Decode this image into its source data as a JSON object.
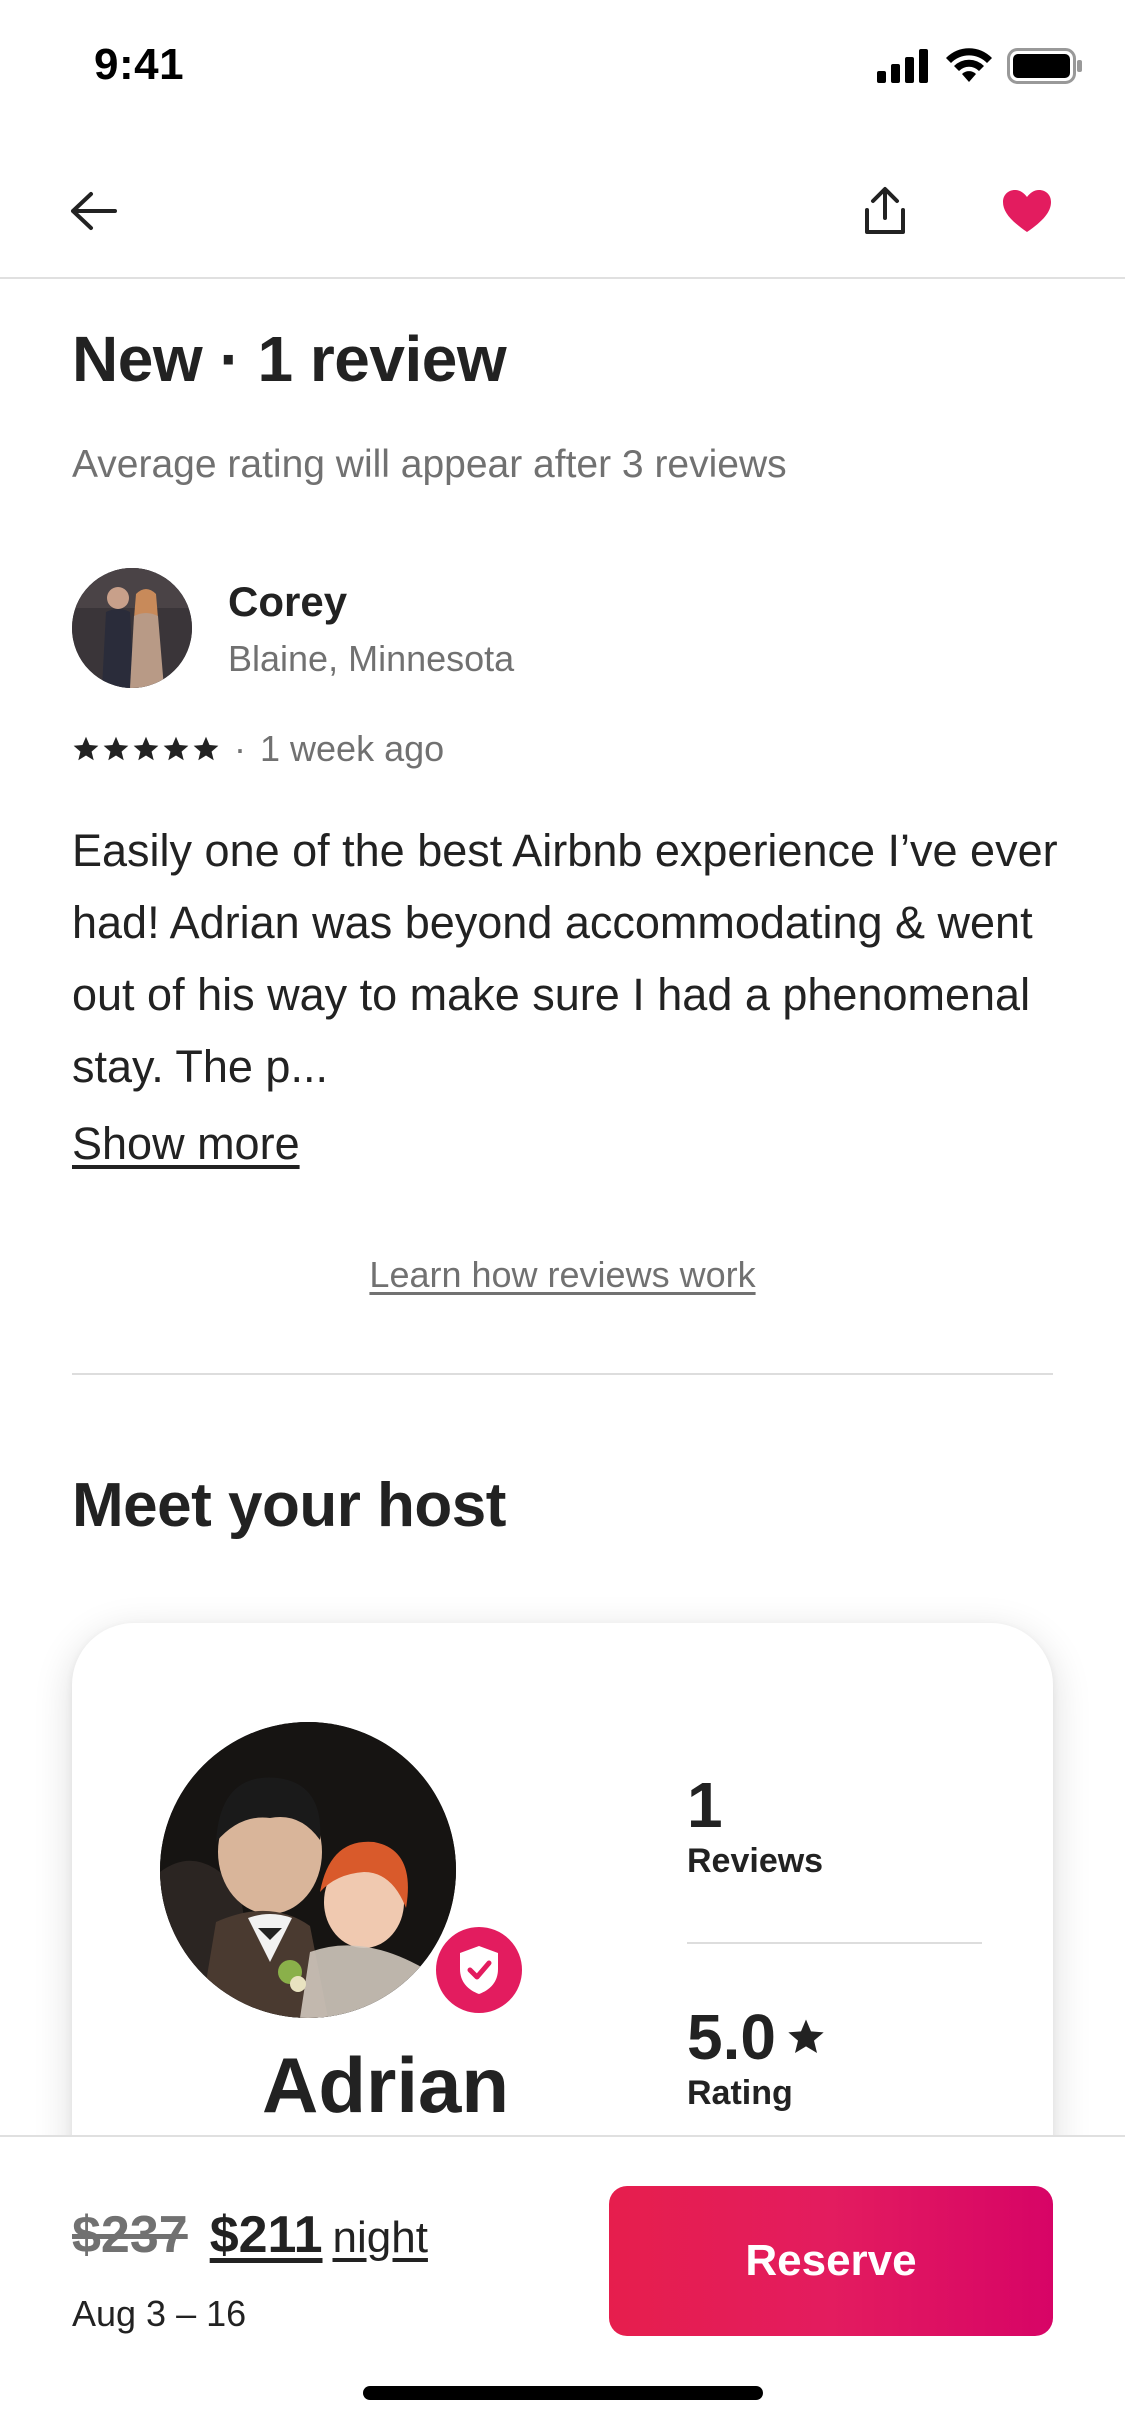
{
  "status_bar": {
    "time": "9:41"
  },
  "nav": {
    "back_icon": "arrow-left-icon",
    "share_icon": "share-icon",
    "heart_icon": "heart-filled-icon",
    "heart_color": "#e31c5f"
  },
  "reviews": {
    "title": "New · 1 review",
    "subtitle": "Average rating will appear after 3 reviews",
    "review": {
      "name": "Corey",
      "location": "Blaine, Minnesota",
      "stars": 5,
      "time": "1 week ago",
      "text": "Easily one of the best Airbnb experience I’ve ever had! Adrian was beyond accommodating & went out of his way to make sure I had a phenomenal stay. The p...",
      "show_more": "Show more"
    },
    "learn_link": "Learn how reviews work"
  },
  "host": {
    "section_title": "Meet your host",
    "name": "Adrian",
    "badge_icon": "superhost-shield-icon",
    "stats": [
      {
        "value": "1",
        "label": "Reviews"
      },
      {
        "value": "5.0",
        "label": "Rating",
        "icon": "star-icon"
      }
    ]
  },
  "booking": {
    "old_price": "$237",
    "new_price": "$211",
    "unit": "night",
    "dates": "Aug 3 – 16",
    "reserve_label": "Reserve",
    "accent": "#e31c5f"
  }
}
